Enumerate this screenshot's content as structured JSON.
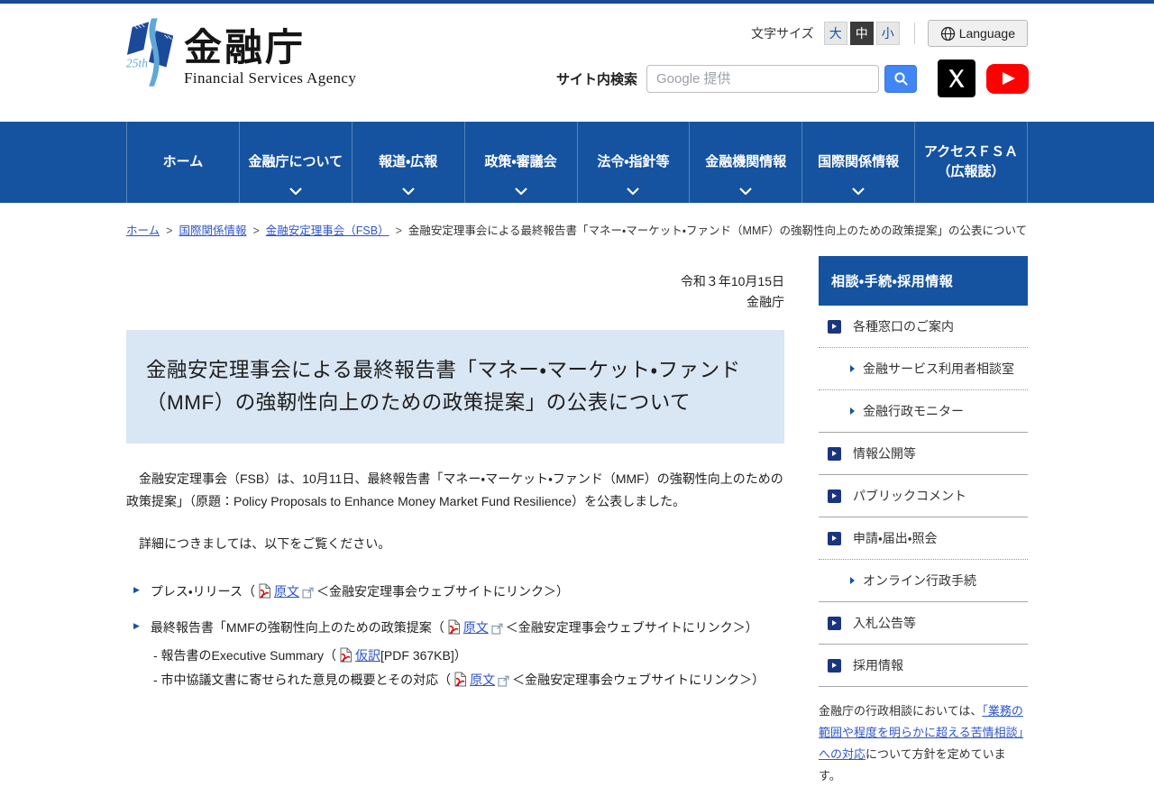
{
  "colors": {
    "nav_blue": "#1553A0",
    "link_blue": "#2F55CB",
    "title_bg": "#D9E6F3",
    "search_button_blue": "#4285F4",
    "youtube_red": "#FF0000"
  },
  "header": {
    "logo": {
      "badge": "25th",
      "title": "金融庁",
      "subtitle": "Financial Services Agency"
    },
    "text_size": {
      "label": "文字サイズ",
      "options": [
        "大",
        "中",
        "小"
      ],
      "selected": "中"
    },
    "language_label": "Language",
    "search": {
      "label": "サイト内検索",
      "value": "",
      "placeholder": "Google 提供"
    },
    "social": {
      "x": "x-twitter",
      "youtube": "youtube"
    }
  },
  "nav": {
    "items": [
      {
        "label": "ホーム",
        "chevron": false
      },
      {
        "label": "金融庁について",
        "chevron": true
      },
      {
        "label": "報道・広報",
        "chevron": true
      },
      {
        "label": "政策・審議会",
        "chevron": true
      },
      {
        "label": "法令・指針等",
        "chevron": true
      },
      {
        "label": "金融機関情報",
        "chevron": true
      },
      {
        "label": "国際関係情報",
        "chevron": true
      },
      {
        "label": "アクセスＦＳＡ",
        "label2": "（広報誌）",
        "chevron": false
      }
    ]
  },
  "breadcrumb": {
    "separator": ">",
    "links": [
      "ホーム",
      "国際関係情報",
      "金融安定理事会（FSB）"
    ],
    "current": "金融安定理事会による最終報告書「マネー・マーケット・ファンド（MMF）の強靭性向上のための政策提案」の公表について"
  },
  "article": {
    "date": "令和３年10月15日",
    "agency": "金融庁",
    "title": "金融安定理事会による最終報告書「マネー・マーケット・ファンド（MMF）の強靭性向上のための政策提案」の公表について",
    "paragraph1": "　金融安定理事会（FSB）は、10月11日、最終報告書「マネー・マーケット・ファンド（MMF）の強靭性向上のための政策提案」（原題：Policy Proposals to Enhance Money Market Fund Resilience）を公表しました。",
    "paragraph2": "　詳細につきましては、以下をご覧ください。",
    "links": [
      {
        "pre": "プレス・リリース（",
        "link": "原文",
        "post": "＜金融安定理事会ウェブサイトにリンク＞）"
      },
      {
        "pre": "最終報告書「MMFの強靭性向上のための政策提案（",
        "link": "原文",
        "post": "＜金融安定理事会ウェブサイトにリンク＞）"
      },
      {
        "pre": "- 報告書のExecutive Summary（",
        "link": "仮訳",
        "post": "[PDF 367KB]）"
      },
      {
        "pre": "- 市中協議文書に寄せられた意見の概要とその対応（",
        "link": "原文",
        "post": "＜金融安定理事会ウェブサイトにリンク＞）"
      }
    ]
  },
  "sidebar": {
    "header": "相談・手続・採用情報",
    "items": [
      {
        "label": "各種窓口のご案内"
      },
      {
        "label": "金融サービス利用者相談室"
      },
      {
        "label": "金融行政モニター"
      },
      {
        "label": "情報公開等"
      },
      {
        "label": "パブリックコメント"
      },
      {
        "label": "申請・届出・照会"
      },
      {
        "label": "オンライン行政手続"
      },
      {
        "label": "入札公告等"
      },
      {
        "label": "採用情報"
      }
    ],
    "note": {
      "pre": "金融庁の行政相談においては、",
      "link": "「業務の範囲や程度を明らかに超える苦情相談」への対応",
      "post": "について方針を定めています。"
    }
  }
}
